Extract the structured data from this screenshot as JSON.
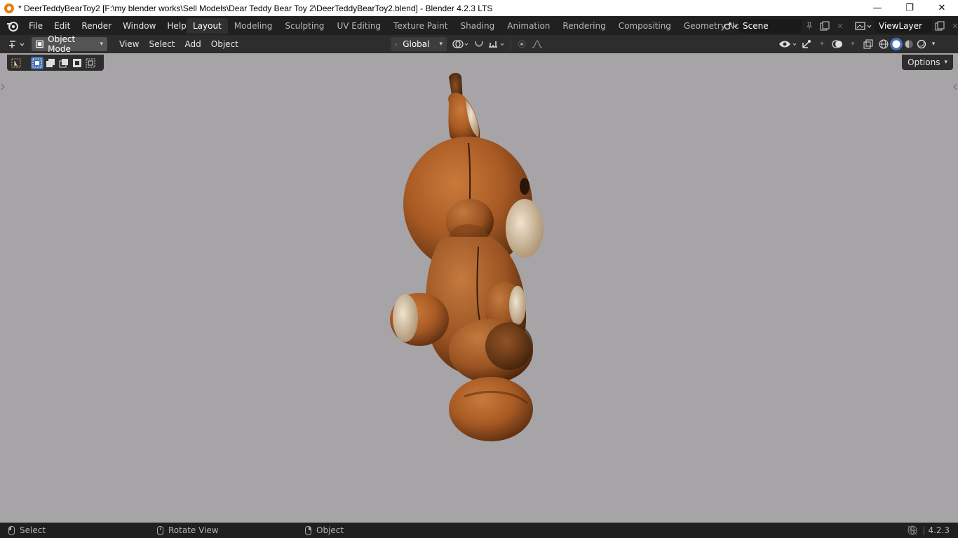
{
  "window": {
    "title": "* DeerTeddyBearToy2 [F:\\my blender works\\Sell Models\\Dear Teddy Bear Toy 2\\DeerTeddyBearToy2.blend] - Blender 4.2.3 LTS",
    "minimize": "—",
    "restore": "❐",
    "close": "✕"
  },
  "menu": {
    "file": "File",
    "edit": "Edit",
    "render": "Render",
    "window": "Window",
    "help": "Help"
  },
  "workspaces": [
    {
      "label": "Layout",
      "active": true
    },
    {
      "label": "Modeling"
    },
    {
      "label": "Sculpting"
    },
    {
      "label": "UV Editing"
    },
    {
      "label": "Texture Paint"
    },
    {
      "label": "Shading"
    },
    {
      "label": "Animation"
    },
    {
      "label": "Rendering"
    },
    {
      "label": "Compositing"
    },
    {
      "label": "Geometry Nodes"
    }
  ],
  "scene": {
    "name": "Scene",
    "view_layer": "ViewLayer"
  },
  "header3d": {
    "mode": "Object Mode",
    "view": "View",
    "select": "Select",
    "add": "Add",
    "object": "Object",
    "orientation": "Global"
  },
  "viewport": {
    "options_label": "Options",
    "background_color": "#a6a4a6"
  },
  "status": {
    "select": "Select",
    "rotate": "Rotate View",
    "object": "Object",
    "version": "4.2.3"
  },
  "colors": {
    "accent": "#4772b3",
    "blender_orange": "#e87d0d"
  }
}
